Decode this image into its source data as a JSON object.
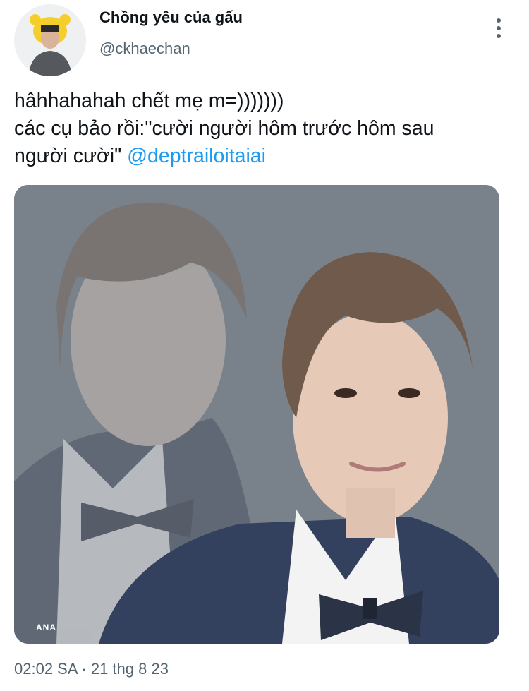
{
  "author": {
    "display_name": "Chồng yêu của gấu",
    "handle": "@ckhaechan",
    "avatar_icon": "user-avatar"
  },
  "tweet": {
    "line1": "hâhhahahah chết mẹ m=)))))))",
    "line2": "các cụ bảo rồi:\"cười người hôm trước hôm sau",
    "line3_text": "người cười\" ",
    "mention": "@deptrailoitaiai"
  },
  "media": {
    "watermark": "ANA"
  },
  "meta": {
    "timestamp": "02:02 SA · 21 thg 8 23"
  },
  "colors": {
    "link": "#1d9bf0",
    "secondary_text": "#536471",
    "photo_bg": "#79818a"
  },
  "icons": {
    "more": "more-vertical-icon"
  }
}
